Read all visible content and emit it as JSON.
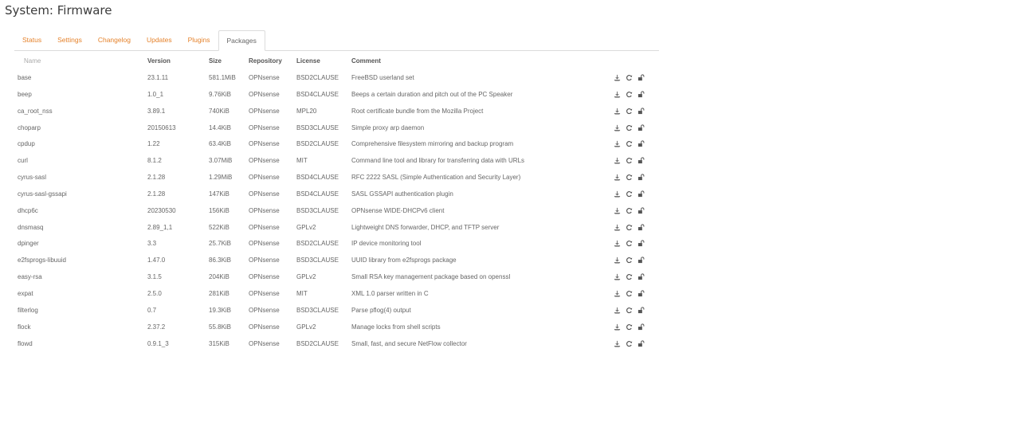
{
  "page": {
    "title": "System: Firmware"
  },
  "tabs": [
    {
      "label": "Status"
    },
    {
      "label": "Settings"
    },
    {
      "label": "Changelog"
    },
    {
      "label": "Updates"
    },
    {
      "label": "Plugins"
    },
    {
      "label": "Packages",
      "active": true
    }
  ],
  "table": {
    "columns": [
      "Name",
      "Version",
      "Size",
      "Repository",
      "License",
      "Comment"
    ],
    "rows": [
      [
        "base",
        "23.1.11",
        "581.1MiB",
        "OPNsense",
        "BSD2CLAUSE",
        "FreeBSD userland set"
      ],
      [
        "beep",
        "1.0_1",
        "9.76KiB",
        "OPNsense",
        "BSD4CLAUSE",
        "Beeps a certain duration and pitch out of the PC Speaker"
      ],
      [
        "ca_root_nss",
        "3.89.1",
        "740KiB",
        "OPNsense",
        "MPL20",
        "Root certificate bundle from the Mozilla Project"
      ],
      [
        "choparp",
        "20150613",
        "14.4KiB",
        "OPNsense",
        "BSD3CLAUSE",
        "Simple proxy arp daemon"
      ],
      [
        "cpdup",
        "1.22",
        "63.4KiB",
        "OPNsense",
        "BSD2CLAUSE",
        "Comprehensive filesystem mirroring and backup program"
      ],
      [
        "curl",
        "8.1.2",
        "3.07MiB",
        "OPNsense",
        "MIT",
        "Command line tool and library for transferring data with URLs"
      ],
      [
        "cyrus-sasl",
        "2.1.28",
        "1.29MiB",
        "OPNsense",
        "BSD4CLAUSE",
        "RFC 2222 SASL (Simple Authentication and Security Layer)"
      ],
      [
        "cyrus-sasl-gssapi",
        "2.1.28",
        "147KiB",
        "OPNsense",
        "BSD4CLAUSE",
        "SASL GSSAPI authentication plugin"
      ],
      [
        "dhcp6c",
        "20230530",
        "156KiB",
        "OPNsense",
        "BSD3CLAUSE",
        "OPNsense WIDE-DHCPv6 client"
      ],
      [
        "dnsmasq",
        "2.89_1,1",
        "522KiB",
        "OPNsense",
        "GPLv2",
        "Lightweight DNS forwarder, DHCP, and TFTP server"
      ],
      [
        "dpinger",
        "3.3",
        "25.7KiB",
        "OPNsense",
        "BSD2CLAUSE",
        "IP device monitoring tool"
      ],
      [
        "e2fsprogs-libuuid",
        "1.47.0",
        "86.3KiB",
        "OPNsense",
        "BSD3CLAUSE",
        "UUID library from e2fsprogs package"
      ],
      [
        "easy-rsa",
        "3.1.5",
        "204KiB",
        "OPNsense",
        "GPLv2",
        "Small RSA key management package based on openssl"
      ],
      [
        "expat",
        "2.5.0",
        "281KiB",
        "OPNsense",
        "MIT",
        "XML 1.0 parser written in C"
      ],
      [
        "filterlog",
        "0.7",
        "19.3KiB",
        "OPNsense",
        "BSD3CLAUSE",
        "Parse pflog(4) output"
      ],
      [
        "flock",
        "2.37.2",
        "55.8KiB",
        "OPNsense",
        "GPLv2",
        "Manage locks from shell scripts"
      ],
      [
        "flowd",
        "0.9.1_3",
        "315KiB",
        "OPNsense",
        "BSD2CLAUSE",
        "Small, fast, and secure NetFlow collector"
      ]
    ],
    "row_actions": [
      "license-icon",
      "reinstall-icon",
      "lock-icon"
    ]
  }
}
